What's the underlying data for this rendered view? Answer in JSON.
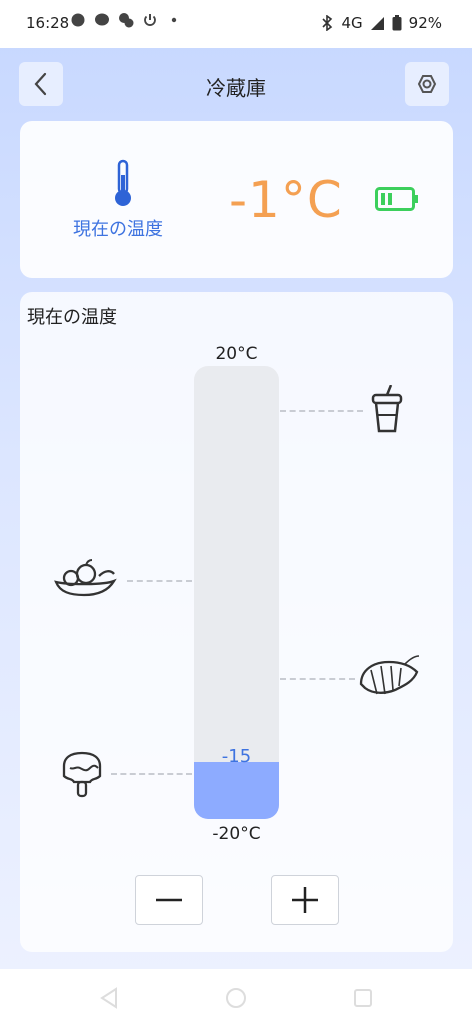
{
  "status": {
    "time": "16:28",
    "network": "4G",
    "battery": "92%"
  },
  "header": {
    "title": "冷蔵庫"
  },
  "current": {
    "label": "現在の温度",
    "temp": "-1°C",
    "battery_color": "#3ccf5c"
  },
  "section": {
    "title": "現在の温度"
  },
  "scale": {
    "max_label": "20°C",
    "min_label": "-20°C",
    "min": -20,
    "max": 20,
    "set_value": "-15",
    "set_number": -15
  },
  "colors": {
    "accent": "#3e73e0",
    "temp": "#f4a052",
    "fill": "#8dabff"
  },
  "icons": {
    "drink": "drink-cup-icon",
    "fruit": "fruit-basket-icon",
    "shrimp": "shrimp-icon",
    "icecream": "ice-cream-icon"
  }
}
